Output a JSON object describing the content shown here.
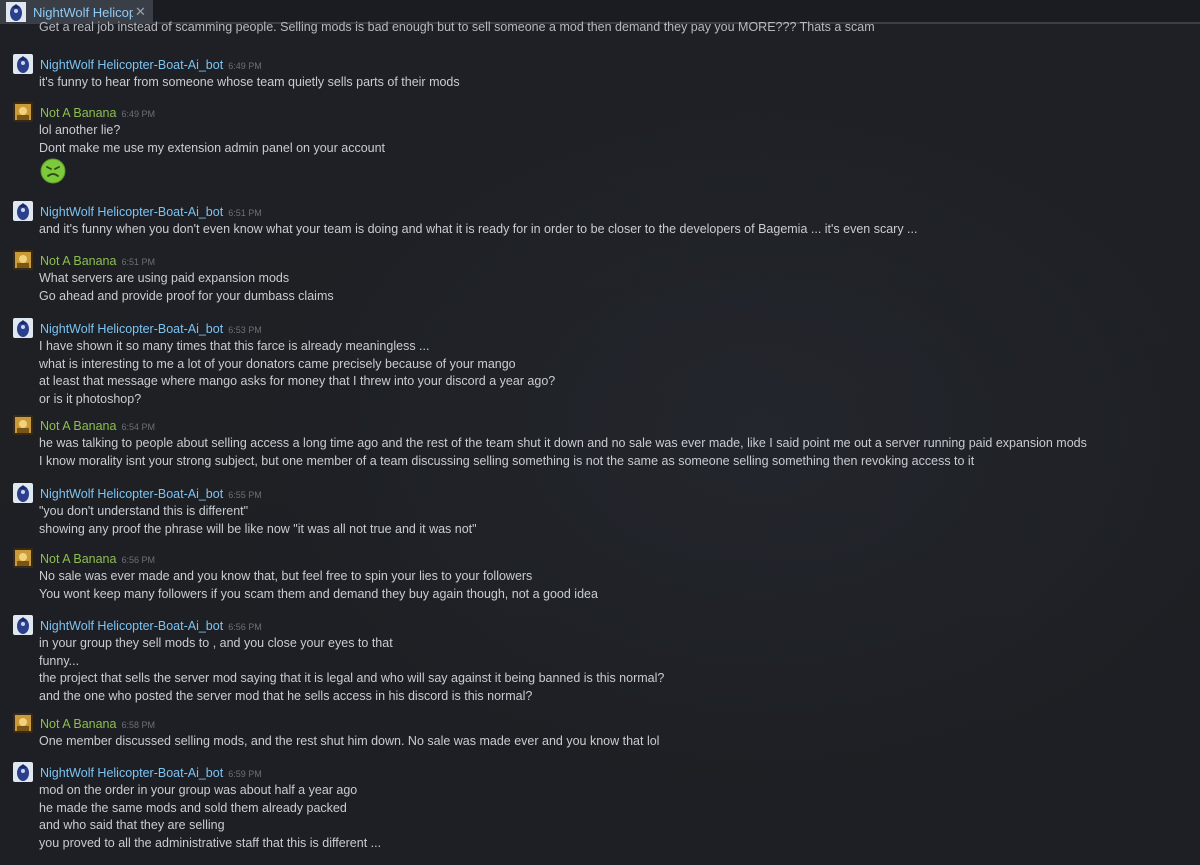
{
  "tab": {
    "title": "NightWolf Helicopter-Boat-Ai_bot",
    "close": "✕"
  },
  "partial_top_line": "Get a real job instead of scamming people. Selling mods is bad enough but to sell someone a mod then demand they pay you MORE??? Thats a scam",
  "colors": {
    "bot_name": "#7cc3f2",
    "banana_name": "#8cbf4e",
    "text": "#c9ccd1",
    "time": "#6b7078",
    "tab_bg": "#3a3e46"
  },
  "messages": [
    {
      "author": "NightWolf Helicopter-Boat-Ai_bot",
      "time": "6:49 PM",
      "lines": [
        "it's funny to hear from someone whose team quietly sells parts of their mods"
      ]
    },
    {
      "author": "Not A Banana",
      "time": "6:49 PM",
      "lines": [
        "lol another lie?",
        "Dont make me use my extension admin panel on your account"
      ],
      "emoji": "sick-face-emoji"
    },
    {
      "author": "NightWolf Helicopter-Boat-Ai_bot",
      "time": "6:51 PM",
      "lines": [
        "and it's funny when you don't even know what your team is doing and what it is ready for in order to be closer to the developers of Bagemia ... it's even scary ..."
      ]
    },
    {
      "author": "Not A Banana",
      "time": "6:51 PM",
      "lines": [
        "What servers are using paid expansion mods",
        "Go ahead and provide proof for your dumbass claims"
      ]
    },
    {
      "author": "NightWolf Helicopter-Boat-Ai_bot",
      "time": "6:53 PM",
      "lines": [
        "I have shown it so many times that this farce is already meaningless ...",
        "what is interesting to me a lot of your donators came precisely because of your mango",
        "at least that message where mango asks for money that I threw into your discord a year ago?",
        "or is it photoshop?"
      ]
    },
    {
      "author": "Not A Banana",
      "time": "6:54 PM",
      "lines": [
        "he was talking to people about selling access a long time ago and the rest of the team shut it down and no sale was ever made, like I said point me out a server running paid expansion mods",
        "I know morality isnt your strong subject, but one member of a team discussing selling something is not the same as someone selling something then revoking access to it"
      ]
    },
    {
      "author": "NightWolf Helicopter-Boat-Ai_bot",
      "time": "6:55 PM",
      "lines": [
        "\"you don't understand this is different\"",
        "showing any proof the phrase will be like now \"it was all not true and it was not\""
      ]
    },
    {
      "author": "Not A Banana",
      "time": "6:56 PM",
      "lines": [
        "No sale was ever made and you know that, but feel free to spin your lies to your followers",
        "You wont keep many followers if you scam them and demand they buy again though, not a good idea"
      ]
    },
    {
      "author": "NightWolf Helicopter-Boat-Ai_bot",
      "time": "6:56 PM",
      "lines": [
        "in your group they sell mods to , and you close your eyes to that",
        "funny...",
        "the project that sells the server mod saying that it is legal and who will say against it being banned is this normal?",
        "and the one who posted the server mod that he sells access in his discord is this normal?"
      ]
    },
    {
      "author": "Not A Banana",
      "time": "6:58 PM",
      "lines": [
        "One member discussed selling mods, and the rest shut him down. No sale was made ever and you know that lol"
      ]
    },
    {
      "author": "NightWolf Helicopter-Boat-Ai_bot",
      "time": "6:59 PM",
      "lines": [
        "mod on the order in your group was about half a year ago",
        "he made the same mods and sold them already packed",
        "and who said that they are selling",
        "you proved to all the administrative staff that this is different ..."
      ]
    }
  ]
}
